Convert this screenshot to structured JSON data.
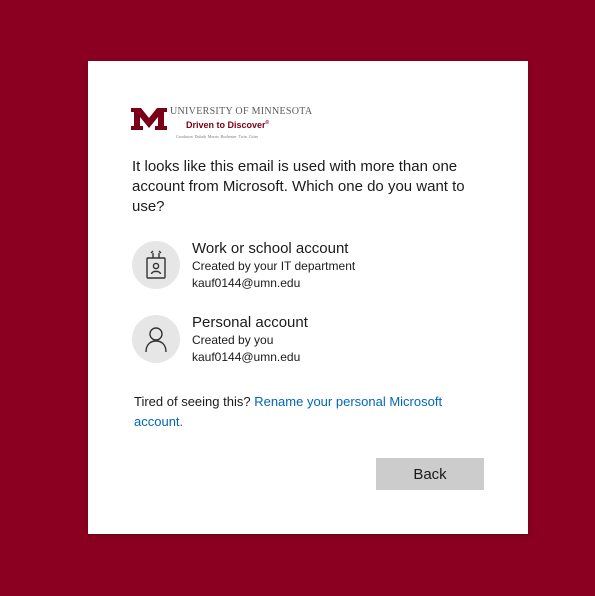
{
  "logo": {
    "university": "UNIVERSITY OF MINNESOTA",
    "tagline": "Driven to Discover",
    "tagline_mark": "®",
    "campuses": "Crookston  Duluth  Morris  Rochester  Twin Cities",
    "brand_color": "#7a0019",
    "icon": "block-m-logo"
  },
  "prompt": "It looks like this email is used with more than one account from Microsoft. Which one do you want to use?",
  "accounts": [
    {
      "title": "Work or school account",
      "subtitle": "Created by your IT department",
      "email": "kauf0144@umn.edu",
      "icon": "badge-icon"
    },
    {
      "title": "Personal account",
      "subtitle": "Created by you",
      "email": "kauf0144@umn.edu",
      "icon": "person-icon"
    }
  ],
  "footer": {
    "text": "Tired of seeing this? ",
    "link": "Rename your personal Microsoft account."
  },
  "back_label": "Back",
  "colors": {
    "background": "#8b0020",
    "link": "#0067b8",
    "button": "#cccccc"
  }
}
